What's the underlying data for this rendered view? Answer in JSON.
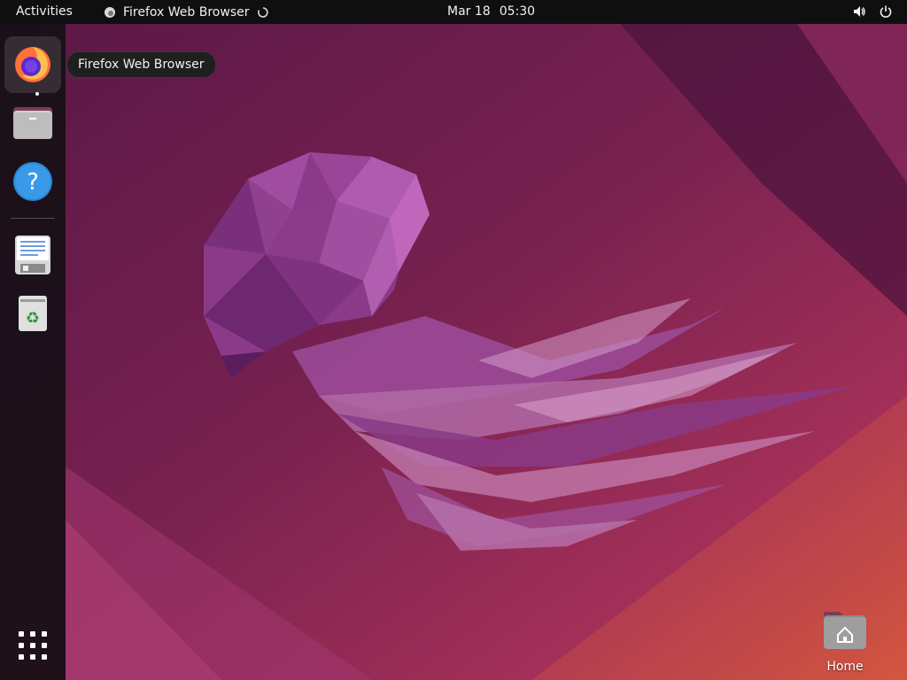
{
  "topbar": {
    "activities_label": "Activities",
    "app_menu_label": "Firefox Web Browser",
    "clock_date": "Mar 18",
    "clock_time": "05:30"
  },
  "dock": {
    "apps": [
      {
        "name": "Firefox Web Browser",
        "icon": "firefox-icon",
        "active": true
      },
      {
        "name": "Files",
        "icon": "files-icon",
        "active": false
      },
      {
        "name": "Help",
        "icon": "help-icon",
        "active": false
      },
      {
        "name": "Text Editor",
        "icon": "text-editor-icon",
        "active": false
      },
      {
        "name": "Trash",
        "icon": "trash-icon",
        "active": false
      }
    ],
    "show_apps_icon": "app-grid-icon"
  },
  "tooltip": {
    "text": "Firefox Web Browser"
  },
  "desktop": {
    "home_label": "Home",
    "home_icon": "home-folder-icon"
  },
  "colors": {
    "topbar_bg": "#0f0f10",
    "wallpaper_dark": "#4a1740",
    "wallpaper_mid": "#8a2a62",
    "wallpaper_warm": "#d0503f",
    "accent_orange": "#e95420"
  }
}
